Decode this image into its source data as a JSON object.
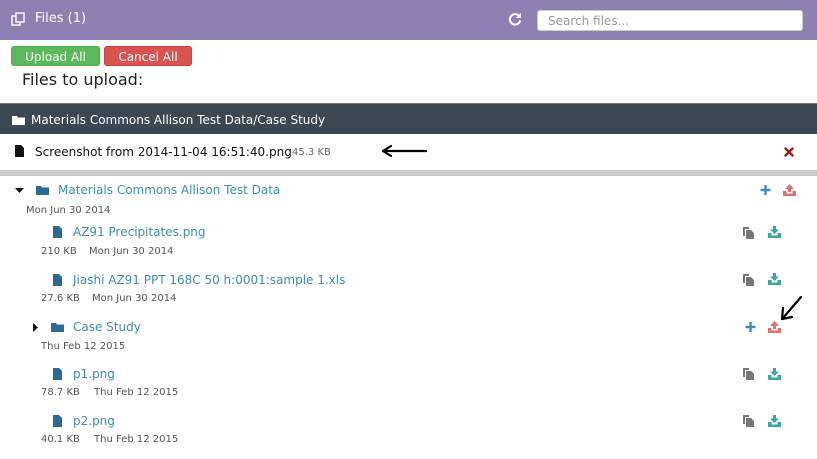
{
  "header": {
    "title": "Files (1)",
    "search_placeholder": "Search files..."
  },
  "upload": {
    "upload_all_label": "Upload All",
    "cancel_all_label": "Cancel All",
    "files_to_upload_label": "Files to upload:",
    "target_folder": "Materials Commons Allison Test Data/Case Study",
    "queued_file": {
      "name": "Screenshot from 2014-11-04 16:51:40.png",
      "size": "45.3 KB"
    }
  },
  "tree": {
    "root": {
      "name": "Materials Commons Allison Test Data",
      "date": "Mon Jun 30 2014"
    },
    "file1": {
      "name": "AZ91 Precipitates.png",
      "size": "210 KB",
      "date": "Mon Jun 30 2014"
    },
    "file2": {
      "name": "Jiashi AZ91 PPT 168C 50 h:0001:sample 1.xls",
      "size": "27.6 KB",
      "date": "Mon Jun 30 2014"
    },
    "case_study": {
      "name": "Case Study",
      "date": "Thu Feb 12 2015"
    },
    "file3": {
      "name": "p1.png",
      "size": "78.7 KB",
      "date": "Thu Feb 12 2015"
    },
    "file4": {
      "name": "p2.png",
      "size": "40.1 KB",
      "date": "Thu Feb 12 2015"
    }
  },
  "colors": {
    "header": "#8f80b4",
    "folder_bar": "#3c4752",
    "link": "#3a8fb7",
    "upload_button": "#5cb85c",
    "cancel_button": "#d9534f",
    "add_action": "#3a8fb7",
    "upload_action": "#e0706c",
    "download_action": "#3aa6a0",
    "remove": "#a01818"
  },
  "icons": {
    "header": [
      "files-icon",
      "refresh-icon"
    ],
    "rows": [
      "folder-icon",
      "file-icon",
      "copy-icon",
      "download-icon",
      "add-icon",
      "upload-icon",
      "remove-icon",
      "arrow-annotation"
    ]
  }
}
